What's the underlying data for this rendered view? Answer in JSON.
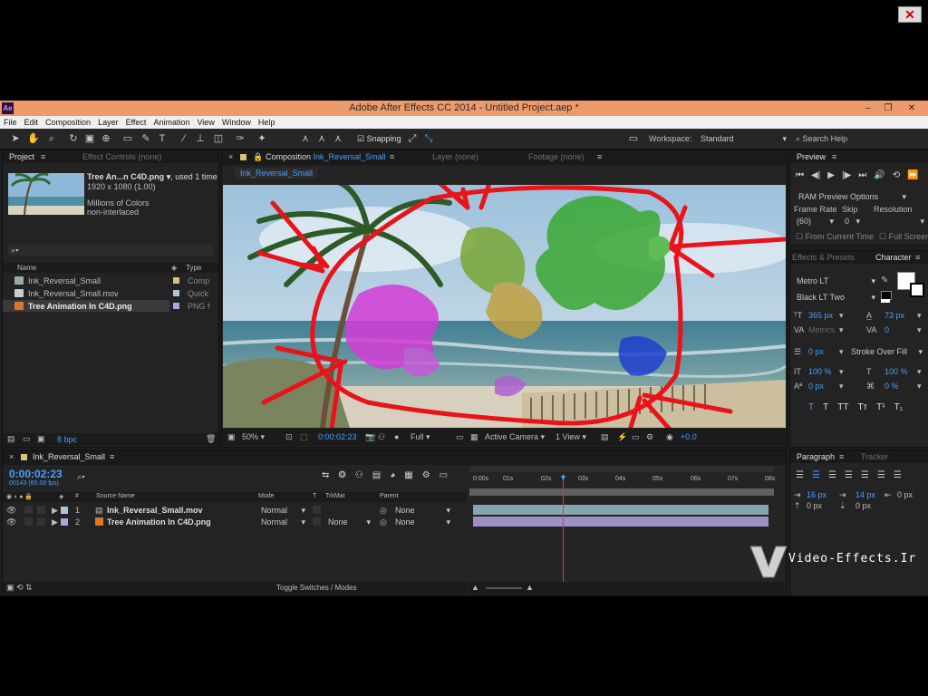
{
  "window": {
    "title": "Adobe After Effects CC 2014 - Untitled Project.aep *",
    "app_icon": "Ae",
    "controls": [
      "–",
      "❐",
      "✕"
    ]
  },
  "menu": [
    "File",
    "Edit",
    "Composition",
    "Layer",
    "Effect",
    "Animation",
    "View",
    "Window",
    "Help"
  ],
  "toolbar": {
    "snapping_label": "Snapping",
    "workspace_label": "Workspace:",
    "workspace_value": "Standard",
    "search_help": "Search Help"
  },
  "project": {
    "tab": "Project",
    "tab2": "Effect Controls (none)",
    "selected_name": "Tree An...n C4D.png",
    "used": ", used 1 time",
    "dims": "1920 x 1080 (1.00)",
    "colors": "Millions of Colors",
    "interlace": "non-interlaced",
    "search_placeholder": "",
    "col_name": "Name",
    "col_type": "Type",
    "items": [
      {
        "name": "Ink_Reversal_Small",
        "type": "Comp",
        "color": "#d8c27a"
      },
      {
        "name": "Ink_Reversal_Small.mov",
        "type": "Quick",
        "color": "#a9c7d8"
      },
      {
        "name": "Tree Animation In C4D.png",
        "type": "PNG f",
        "color": "#b0a3e0"
      }
    ],
    "bpc": "8 bpc"
  },
  "composition": {
    "tab_prefix": "Composition",
    "tab_name": "Ink_Reversal_Small",
    "layer_tab": "Layer (none)",
    "footage_tab": "Footage (none)",
    "comp_label": "Ink_Reversal_Small",
    "zoom": "50%",
    "timecode": "0:00:02:23",
    "resolution": "Full",
    "camera": "Active Camera",
    "view": "1 View",
    "exposure": "+0.0"
  },
  "preview": {
    "tab": "Preview",
    "ram_options": "RAM Preview Options",
    "frame_rate_label": "Frame Rate",
    "skip_label": "Skip",
    "resolution_label": "Resolution",
    "frame_rate": "(60)",
    "skip": "0",
    "from_current": "From Current Time",
    "full_screen": "Full Screen"
  },
  "character": {
    "tab_effects": "Effects & Presets",
    "tab": "Character",
    "font": "Metro LT",
    "style": "Black LT Two",
    "size": "365 px",
    "leading": "73 px",
    "kerning": "Metrics",
    "tracking": "0",
    "stroke_width": "0 px",
    "stroke_type": "Stroke Over Fill",
    "vscale": "100 %",
    "hscale": "100 %",
    "baseline": "0 px",
    "tsume": "0 %",
    "styles": [
      "T",
      "T",
      "TT",
      "Tт",
      "T¹",
      "T₁"
    ]
  },
  "paragraph": {
    "tab": "Paragraph",
    "tab2": "Tracker",
    "indent_left": "16 px",
    "indent_first": "14 px",
    "indent_right": "0 px",
    "space_before": "0 px",
    "space_after": "0 px"
  },
  "timeline": {
    "tab": "Ink_Reversal_Small",
    "timecode": "0:00:02:23",
    "frames": "00143 (60.00 fps)",
    "col_source": "Source Name",
    "col_mode": "Mode",
    "col_t": "T",
    "col_trkmat": "TrkMat",
    "col_parent": "Parent",
    "layers": [
      {
        "num": "1",
        "name": "Ink_Reversal_Small.mov",
        "mode": "Normal",
        "trkmat": "",
        "parent": "None",
        "color": "#a9c7d8"
      },
      {
        "num": "2",
        "name": "Tree Animation In C4D.png",
        "mode": "Normal",
        "trkmat": "None",
        "parent": "None",
        "color": "#b0a3e0"
      }
    ],
    "ruler": [
      "0:00s",
      "01s",
      "02s",
      "03s",
      "04s",
      "05s",
      "06s",
      "07s",
      "08s"
    ],
    "playhead_seconds": 2.4,
    "toggle_label": "Toggle Switches / Modes"
  },
  "watermark": "Video-Effects.Ir",
  "colors": {
    "accent": "#4a9eff",
    "title_bar": "#ee9b6b",
    "annotation": "#e8141a",
    "playhead": "#d93b3b"
  }
}
